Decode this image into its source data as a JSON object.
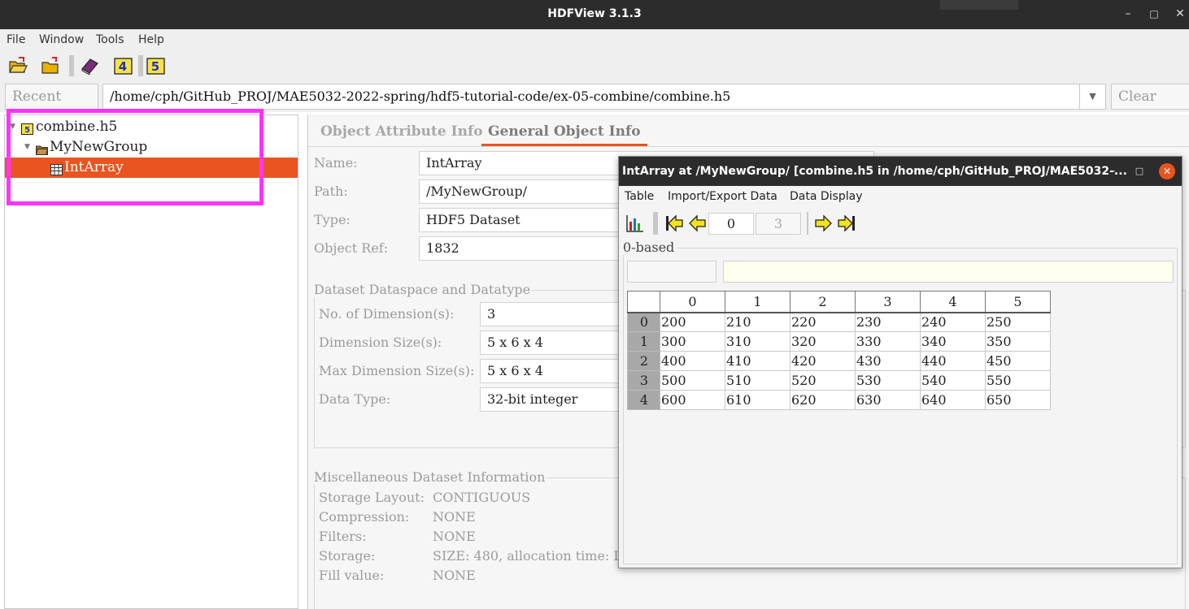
{
  "window": {
    "title": "HDFView 3.1.3",
    "minimize": "–",
    "maximize": "□",
    "close": "✕"
  },
  "menu": [
    "File",
    "Window",
    "Tools",
    "Help"
  ],
  "toolbar": {
    "icons": [
      "open-file-icon",
      "open-folder-icon",
      "book-icon",
      "hdf4-icon",
      "hdf5-icon"
    ]
  },
  "pathbar": {
    "recent_label": "Recent Files",
    "path": "/home/cph/GitHub_PROJ/MAE5032-2022-spring/hdf5-tutorial-code/ex-05-combine/combine.h5",
    "clear_label": "Clear Text"
  },
  "tree": {
    "items": [
      {
        "label": "combine.h5"
      },
      {
        "label": "MyNewGroup"
      },
      {
        "label": "IntArray"
      }
    ]
  },
  "tabs": [
    "Object Attribute Info",
    "General Object Info"
  ],
  "general": {
    "name_label": "Name:",
    "name_value": "IntArray",
    "path_label": "Path:",
    "path_value": "/MyNewGroup/",
    "type_label": "Type:",
    "type_value": "HDF5 Dataset",
    "ref_label": "Object Ref:",
    "ref_value": "1832"
  },
  "dataspace": {
    "title": "Dataset Dataspace and Datatype",
    "ndim_label": "No. of Dimension(s):",
    "ndim_value": "3",
    "dimsize_label": "Dimension Size(s):",
    "dimsize_value": "5 x 6 x 4",
    "maxdim_label": "Max Dimension Size(s):",
    "maxdim_value": "5 x 6 x 4",
    "dtype_label": "Data Type:",
    "dtype_value": "32-bit integer"
  },
  "misc": {
    "title": "Miscellaneous Dataset Information",
    "layout_label": "Storage Layout:",
    "layout_value": "CONTIGUOUS",
    "compression_label": "Compression:",
    "compression_value": "NONE",
    "filters_label": "Filters:",
    "filters_value": "NONE",
    "storage_label": "Storage:",
    "storage_value": "SIZE: 480, allocation time: L",
    "fill_label": "Fill value:",
    "fill_value": "NONE"
  },
  "dialog": {
    "title": "IntArray  at  /MyNewGroup/  [combine.h5  in  /home/cph/GitHub_PROJ/MAE5032-...",
    "minimize": "–",
    "maximize": "□",
    "close": "✕",
    "menu": [
      "Table",
      "Import/Export Data",
      "Data Display"
    ],
    "page_current": "0",
    "page_max": "3",
    "index_base": "0-based",
    "columns": [
      "0",
      "1",
      "2",
      "3",
      "4",
      "5"
    ],
    "rows": [
      {
        "index": "0",
        "cells": [
          "200",
          "210",
          "220",
          "230",
          "240",
          "250"
        ]
      },
      {
        "index": "1",
        "cells": [
          "300",
          "310",
          "320",
          "330",
          "340",
          "350"
        ]
      },
      {
        "index": "2",
        "cells": [
          "400",
          "410",
          "420",
          "430",
          "440",
          "450"
        ]
      },
      {
        "index": "3",
        "cells": [
          "500",
          "510",
          "520",
          "530",
          "540",
          "550"
        ]
      },
      {
        "index": "4",
        "cells": [
          "600",
          "610",
          "620",
          "630",
          "640",
          "650"
        ]
      }
    ]
  }
}
